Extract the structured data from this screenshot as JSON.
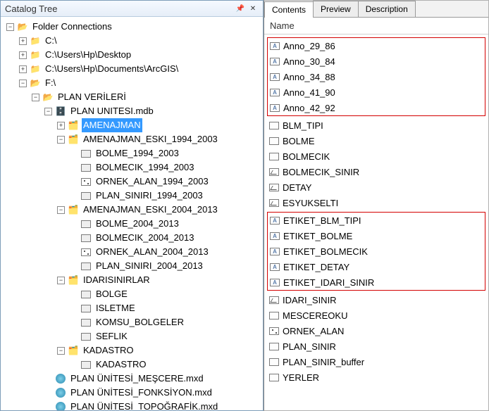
{
  "leftPane": {
    "title": "Catalog Tree",
    "tree": [
      {
        "level": 0,
        "exp": "minus",
        "icon": "folder-open",
        "label": "Folder Connections"
      },
      {
        "level": 1,
        "exp": "plus",
        "icon": "folder",
        "label": "C:\\"
      },
      {
        "level": 1,
        "exp": "plus",
        "icon": "folder",
        "label": "C:\\Users\\Hp\\Desktop"
      },
      {
        "level": 1,
        "exp": "plus",
        "icon": "folder",
        "label": "C:\\Users\\Hp\\Documents\\ArcGIS\\"
      },
      {
        "level": 1,
        "exp": "minus",
        "icon": "folder-open",
        "label": "F:\\"
      },
      {
        "level": 2,
        "exp": "minus",
        "icon": "folder-open",
        "label": "PLAN VERİLERİ"
      },
      {
        "level": 3,
        "exp": "minus",
        "icon": "db",
        "label": "PLAN UNITESI.mdb"
      },
      {
        "level": 4,
        "exp": "plus",
        "icon": "ds",
        "label": "AMENAJMAN",
        "selected": true
      },
      {
        "level": 4,
        "exp": "minus",
        "icon": "ds",
        "label": "AMENAJMAN_ESKI_1994_2003",
        "box": "_ESKI_1994_2003"
      },
      {
        "level": 5,
        "exp": "none",
        "icon": "fc",
        "label": "BOLME_1994_2003"
      },
      {
        "level": 5,
        "exp": "none",
        "icon": "fc",
        "label": "BOLMECIK_1994_2003",
        "box": "_1994_2003"
      },
      {
        "level": 5,
        "exp": "none",
        "icon": "point",
        "label": "ORNEK_ALAN_1994_2003"
      },
      {
        "level": 5,
        "exp": "none",
        "icon": "fc",
        "label": "PLAN_SINIRI_1994_2003"
      },
      {
        "level": 4,
        "exp": "minus",
        "icon": "ds",
        "label": "AMENAJMAN_ESKI_2004_2013",
        "box": "_ESKI_2004_2013"
      },
      {
        "level": 5,
        "exp": "none",
        "icon": "fc",
        "label": "BOLME_2004_2013"
      },
      {
        "level": 5,
        "exp": "none",
        "icon": "fc",
        "label": "BOLMECIK_2004_2013"
      },
      {
        "level": 5,
        "exp": "none",
        "icon": "point",
        "label": "ORNEK_ALAN_2004_2013"
      },
      {
        "level": 5,
        "exp": "none",
        "icon": "fc",
        "label": "PLAN_SINIRI_2004_2013"
      },
      {
        "level": 4,
        "exp": "minus",
        "icon": "ds",
        "label": "IDARISINIRLAR"
      },
      {
        "level": 5,
        "exp": "none",
        "icon": "fc",
        "label": "BOLGE"
      },
      {
        "level": 5,
        "exp": "none",
        "icon": "fc",
        "label": "ISLETME"
      },
      {
        "level": 5,
        "exp": "none",
        "icon": "fc",
        "label": "KOMSU_BOLGELER"
      },
      {
        "level": 5,
        "exp": "none",
        "icon": "fc",
        "label": "SEFLIK"
      },
      {
        "level": 4,
        "exp": "minus",
        "icon": "ds",
        "label": "KADASTRO"
      },
      {
        "level": 5,
        "exp": "none",
        "icon": "fc",
        "label": "KADASTRO"
      },
      {
        "level": 3,
        "exp": "none",
        "icon": "mxd",
        "label": "PLAN ÜNİTESİ_MEŞCERE.mxd"
      },
      {
        "level": 3,
        "exp": "none",
        "icon": "mxd",
        "label": "PLAN ÜNİTESİ_FONKSİYON.mxd"
      },
      {
        "level": 3,
        "exp": "none",
        "icon": "mxd",
        "label": "PLAN ÜNİTESİ_TOPOĞRAFİK.mxd"
      }
    ]
  },
  "rightPane": {
    "tabs": [
      {
        "label": "Contents",
        "active": true
      },
      {
        "label": "Preview",
        "active": false
      },
      {
        "label": "Description",
        "active": false
      }
    ],
    "columnHeader": "Name",
    "groups": [
      {
        "boxed": true,
        "items": [
          {
            "icon": "anno",
            "label": "Anno_29_86"
          },
          {
            "icon": "anno",
            "label": "Anno_30_84"
          },
          {
            "icon": "anno",
            "label": "Anno_34_88"
          },
          {
            "icon": "anno",
            "label": "Anno_41_90"
          },
          {
            "icon": "anno",
            "label": "Anno_42_92"
          }
        ]
      },
      {
        "boxed": false,
        "items": [
          {
            "icon": "poly",
            "label": "BLM_TIPI"
          },
          {
            "icon": "poly",
            "label": "BOLME"
          },
          {
            "icon": "poly",
            "label": "BOLMECIK"
          },
          {
            "icon": "line",
            "label": "BOLMECIK_SINIR"
          },
          {
            "icon": "line",
            "label": "DETAY"
          },
          {
            "icon": "line",
            "label": "ESYUKSELTI"
          }
        ]
      },
      {
        "boxed": true,
        "items": [
          {
            "icon": "A",
            "label": "ETIKET_BLM_TIPI"
          },
          {
            "icon": "A",
            "label": "ETIKET_BOLME"
          },
          {
            "icon": "A",
            "label": "ETIKET_BOLMECIK"
          },
          {
            "icon": "A",
            "label": "ETIKET_DETAY"
          },
          {
            "icon": "A",
            "label": "ETIKET_IDARI_SINIR"
          }
        ]
      },
      {
        "boxed": false,
        "items": [
          {
            "icon": "line",
            "label": "IDARI_SINIR"
          },
          {
            "icon": "poly",
            "label": "MESCEREOKU"
          },
          {
            "icon": "point",
            "label": "ORNEK_ALAN"
          },
          {
            "icon": "poly",
            "label": "PLAN_SINIR"
          },
          {
            "icon": "poly",
            "label": "PLAN_SINIR_buffer"
          },
          {
            "icon": "poly",
            "label": "YERLER"
          }
        ]
      }
    ]
  }
}
